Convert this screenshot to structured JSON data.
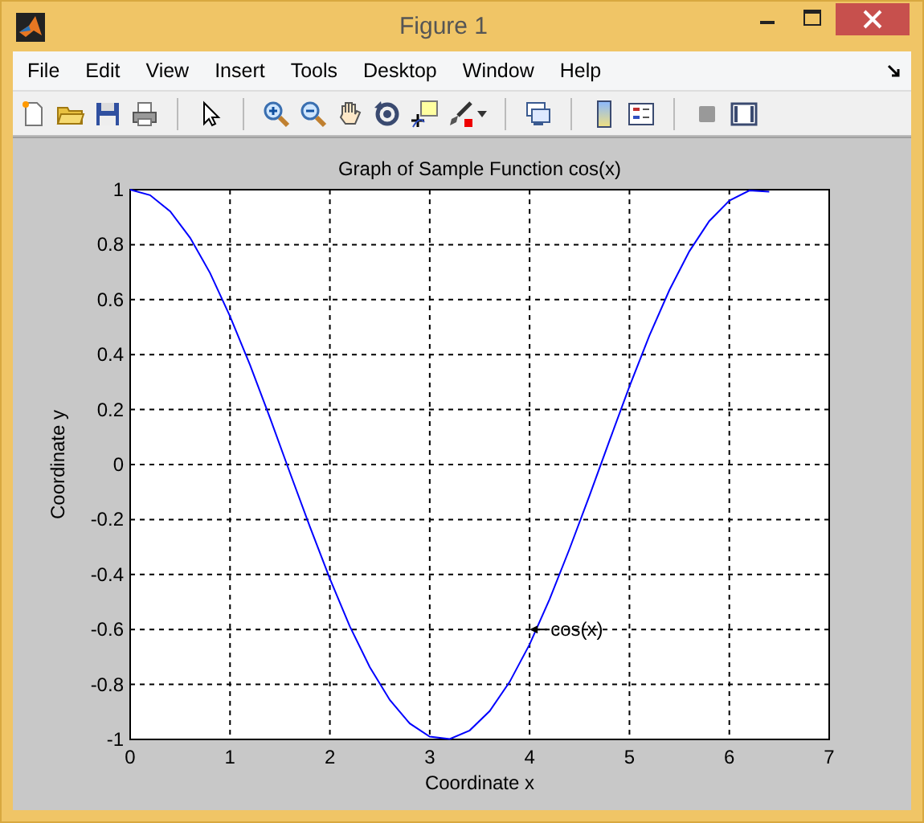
{
  "window": {
    "title": "Figure 1"
  },
  "menu": [
    "File",
    "Edit",
    "View",
    "Insert",
    "Tools",
    "Desktop",
    "Window",
    "Help"
  ],
  "figure": {
    "chart_data": {
      "type": "line",
      "title": "Graph of Sample Function cos(x)",
      "xlabel": "Coordinate x",
      "ylabel": "Coordinate y",
      "x": [
        0,
        0.2,
        0.4,
        0.6,
        0.8,
        1,
        1.2,
        1.4,
        1.6,
        1.8,
        2,
        2.2,
        2.4,
        2.6,
        2.8,
        3,
        3.2,
        3.4,
        3.6,
        3.8,
        4,
        4.2,
        4.4,
        4.6,
        4.8,
        5,
        5.2,
        5.4,
        5.6,
        5.8,
        6,
        6.2,
        6.4
      ],
      "grid": true,
      "series": [
        {
          "color": "#0000ff",
          "values": [
            1,
            0.98,
            0.921,
            0.825,
            0.697,
            0.54,
            0.362,
            0.17,
            -0.029,
            -0.227,
            -0.416,
            -0.589,
            -0.737,
            -0.857,
            -0.942,
            -0.99,
            -0.998,
            -0.967,
            -0.897,
            -0.791,
            -0.654,
            -0.49,
            -0.307,
            -0.112,
            0.087,
            0.284,
            0.469,
            0.635,
            0.776,
            0.886,
            0.96,
            0.997,
            0.993
          ]
        }
      ],
      "xlim": [
        0,
        7
      ],
      "ylim": [
        -1,
        1
      ],
      "xticks": [
        0,
        1,
        2,
        3,
        4,
        5,
        6,
        7
      ],
      "yticks": [
        -1,
        -0.8,
        -0.6,
        -0.4,
        -0.2,
        0,
        0.2,
        0.4,
        0.6,
        0.8,
        1
      ],
      "annotations": [
        {
          "text": "cos(x)",
          "x": 4,
          "y": -0.6
        }
      ]
    }
  }
}
